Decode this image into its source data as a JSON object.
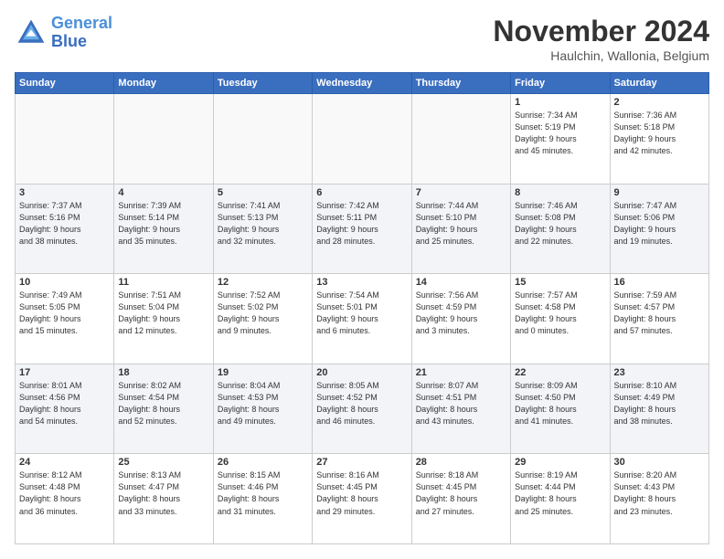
{
  "logo": {
    "line1": "General",
    "line2": "Blue"
  },
  "title": "November 2024",
  "subtitle": "Haulchin, Wallonia, Belgium",
  "days_of_week": [
    "Sunday",
    "Monday",
    "Tuesday",
    "Wednesday",
    "Thursday",
    "Friday",
    "Saturday"
  ],
  "weeks": [
    [
      {
        "day": "",
        "info": ""
      },
      {
        "day": "",
        "info": ""
      },
      {
        "day": "",
        "info": ""
      },
      {
        "day": "",
        "info": ""
      },
      {
        "day": "",
        "info": ""
      },
      {
        "day": "1",
        "info": "Sunrise: 7:34 AM\nSunset: 5:19 PM\nDaylight: 9 hours\nand 45 minutes."
      },
      {
        "day": "2",
        "info": "Sunrise: 7:36 AM\nSunset: 5:18 PM\nDaylight: 9 hours\nand 42 minutes."
      }
    ],
    [
      {
        "day": "3",
        "info": "Sunrise: 7:37 AM\nSunset: 5:16 PM\nDaylight: 9 hours\nand 38 minutes."
      },
      {
        "day": "4",
        "info": "Sunrise: 7:39 AM\nSunset: 5:14 PM\nDaylight: 9 hours\nand 35 minutes."
      },
      {
        "day": "5",
        "info": "Sunrise: 7:41 AM\nSunset: 5:13 PM\nDaylight: 9 hours\nand 32 minutes."
      },
      {
        "day": "6",
        "info": "Sunrise: 7:42 AM\nSunset: 5:11 PM\nDaylight: 9 hours\nand 28 minutes."
      },
      {
        "day": "7",
        "info": "Sunrise: 7:44 AM\nSunset: 5:10 PM\nDaylight: 9 hours\nand 25 minutes."
      },
      {
        "day": "8",
        "info": "Sunrise: 7:46 AM\nSunset: 5:08 PM\nDaylight: 9 hours\nand 22 minutes."
      },
      {
        "day": "9",
        "info": "Sunrise: 7:47 AM\nSunset: 5:06 PM\nDaylight: 9 hours\nand 19 minutes."
      }
    ],
    [
      {
        "day": "10",
        "info": "Sunrise: 7:49 AM\nSunset: 5:05 PM\nDaylight: 9 hours\nand 15 minutes."
      },
      {
        "day": "11",
        "info": "Sunrise: 7:51 AM\nSunset: 5:04 PM\nDaylight: 9 hours\nand 12 minutes."
      },
      {
        "day": "12",
        "info": "Sunrise: 7:52 AM\nSunset: 5:02 PM\nDaylight: 9 hours\nand 9 minutes."
      },
      {
        "day": "13",
        "info": "Sunrise: 7:54 AM\nSunset: 5:01 PM\nDaylight: 9 hours\nand 6 minutes."
      },
      {
        "day": "14",
        "info": "Sunrise: 7:56 AM\nSunset: 4:59 PM\nDaylight: 9 hours\nand 3 minutes."
      },
      {
        "day": "15",
        "info": "Sunrise: 7:57 AM\nSunset: 4:58 PM\nDaylight: 9 hours\nand 0 minutes."
      },
      {
        "day": "16",
        "info": "Sunrise: 7:59 AM\nSunset: 4:57 PM\nDaylight: 8 hours\nand 57 minutes."
      }
    ],
    [
      {
        "day": "17",
        "info": "Sunrise: 8:01 AM\nSunset: 4:56 PM\nDaylight: 8 hours\nand 54 minutes."
      },
      {
        "day": "18",
        "info": "Sunrise: 8:02 AM\nSunset: 4:54 PM\nDaylight: 8 hours\nand 52 minutes."
      },
      {
        "day": "19",
        "info": "Sunrise: 8:04 AM\nSunset: 4:53 PM\nDaylight: 8 hours\nand 49 minutes."
      },
      {
        "day": "20",
        "info": "Sunrise: 8:05 AM\nSunset: 4:52 PM\nDaylight: 8 hours\nand 46 minutes."
      },
      {
        "day": "21",
        "info": "Sunrise: 8:07 AM\nSunset: 4:51 PM\nDaylight: 8 hours\nand 43 minutes."
      },
      {
        "day": "22",
        "info": "Sunrise: 8:09 AM\nSunset: 4:50 PM\nDaylight: 8 hours\nand 41 minutes."
      },
      {
        "day": "23",
        "info": "Sunrise: 8:10 AM\nSunset: 4:49 PM\nDaylight: 8 hours\nand 38 minutes."
      }
    ],
    [
      {
        "day": "24",
        "info": "Sunrise: 8:12 AM\nSunset: 4:48 PM\nDaylight: 8 hours\nand 36 minutes."
      },
      {
        "day": "25",
        "info": "Sunrise: 8:13 AM\nSunset: 4:47 PM\nDaylight: 8 hours\nand 33 minutes."
      },
      {
        "day": "26",
        "info": "Sunrise: 8:15 AM\nSunset: 4:46 PM\nDaylight: 8 hours\nand 31 minutes."
      },
      {
        "day": "27",
        "info": "Sunrise: 8:16 AM\nSunset: 4:45 PM\nDaylight: 8 hours\nand 29 minutes."
      },
      {
        "day": "28",
        "info": "Sunrise: 8:18 AM\nSunset: 4:45 PM\nDaylight: 8 hours\nand 27 minutes."
      },
      {
        "day": "29",
        "info": "Sunrise: 8:19 AM\nSunset: 4:44 PM\nDaylight: 8 hours\nand 25 minutes."
      },
      {
        "day": "30",
        "info": "Sunrise: 8:20 AM\nSunset: 4:43 PM\nDaylight: 8 hours\nand 23 minutes."
      }
    ]
  ]
}
